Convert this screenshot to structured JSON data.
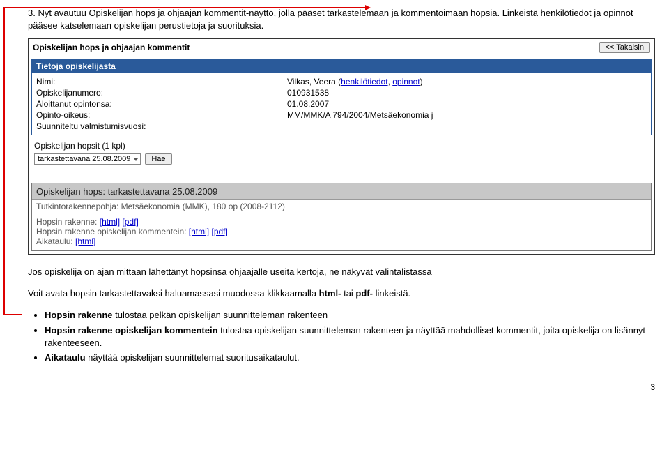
{
  "instruction": "3. Nyt avautuu Opiskelijan hops ja ohjaajan kommentit-näyttö, jolla pääset tarkastelemaan ja kommentoimaan hopsia. Linkeistä henkilötiedot ja opinnot pääsee katselemaan opiskelijan perustietoja ja suorituksia.",
  "app": {
    "title": "Opiskelijan hops ja ohjaajan kommentit",
    "back_label": "<< Takaisin"
  },
  "student_panel": {
    "title": "Tietoja opiskelijasta",
    "rows": [
      {
        "label": "Nimi:",
        "value": "Vilkas, Veera",
        "links": [
          "henkilötiedot",
          "opinnot"
        ]
      },
      {
        "label": "Opiskelijanumero:",
        "value": "010931538"
      },
      {
        "label": "Aloittanut opintonsa:",
        "value": "01.08.2007"
      },
      {
        "label": "Opinto-oikeus:",
        "value": "MM/MMK/A 794/2004/Metsäekonomia j"
      },
      {
        "label": "Suunniteltu valmistumisvuosi:",
        "value": ""
      }
    ]
  },
  "hops_select": {
    "label": "Opiskelijan hopsit (1 kpl)",
    "selected": "tarkastettavana 25.08.2009",
    "button": "Hae"
  },
  "hops_panel": {
    "title": "Opiskelijan hops: tarkastettavana 25.08.2009",
    "subtitle": "Tutkintorakennepohja: Metsäekonomia (MMK), 180 op (2008-2112)",
    "links": {
      "row1_label": "Hopsin rakenne:",
      "row2_label": "Hopsin rakenne opiskelijan kommentein:",
      "row3_label": "Aikataulu:",
      "html": "[html]",
      "pdf": "[pdf]"
    }
  },
  "explanation1": "Jos opiskelija on ajan mittaan lähettänyt hopsinsa ohjaajalle useita kertoja, ne näkyvät valintalistassa",
  "explanation2_pre": "Voit avata hopsin tarkastettavaksi haluamassasi muodossa klikkaamalla ",
  "explanation2_b1": "html-",
  "explanation2_mid": " tai ",
  "explanation2_b2": "pdf-",
  "explanation2_post": " linkeistä.",
  "bullets": {
    "b1_bold": "Hopsin rakenne",
    "b1_rest": " tulostaa pelkän opiskelijan suunnitteleman rakenteen",
    "b2_bold": "Hopsin rakenne opiskelijan kommentein",
    "b2_rest": " tulostaa opiskelijan suunnitteleman rakenteen ja näyttää mahdolliset kommentit, joita opiskelija on lisännyt rakenteeseen.",
    "b3_bold": "Aikataulu",
    "b3_rest": " näyttää opiskelijan suunnittelemat suoritusaikataulut."
  },
  "page_number": "3"
}
